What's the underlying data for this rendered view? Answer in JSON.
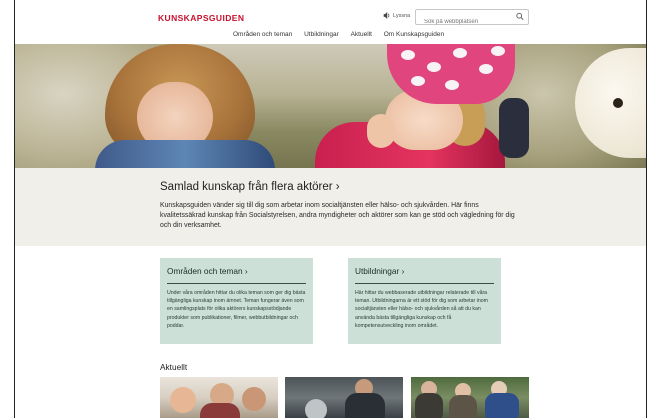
{
  "header": {
    "logo": "KUNSKAPSGUIDEN",
    "listen_label": "Lyssna",
    "search_placeholder": "Sök på webbplatsen"
  },
  "nav": {
    "items": [
      "Områden och teman",
      "Utbildningar",
      "Aktuellt",
      "Om Kunskapsguiden"
    ]
  },
  "intro": {
    "title": "Samlad kunskap från flera aktörer ›",
    "text": "Kunskapsguiden vänder sig till dig som arbetar inom socialtjänsten eller hälso- och sjukvården. Här finns kvalitetssäkrad kunskap från Socialstyrelsen, andra myndigheter och aktörer som kan ge stöd och vägledning för dig och din verksamhet."
  },
  "cards": [
    {
      "title": "Områden och teman ›",
      "text": "Under våra områden hittar du olika teman som ger dig bästa tillgängliga kunskap inom ämnet. Teman fungerar även som en samlingsplats för olika aktörers kunskapsstödjande produkter som publikationer, filmer, webbutbildningar och poddar."
    },
    {
      "title": "Utbildningar ›",
      "text": "Här hittar du webbaserade utbildningar relaterade till våra teman. Utbildningarna är ett stöd för dig som arbetar inom socialtjänsten eller hälso- och sjukvården så att du kan använda bästa tillgängliga kunskap och få kompetensutveckling inom området."
    }
  ],
  "news": {
    "title": "Aktuellt"
  },
  "colors": {
    "brand_red": "#c8102e",
    "card_green": "#cde0d8",
    "intro_bg": "#f1efea"
  },
  "icons": {
    "listen": "speaker-icon",
    "search": "magnifier-icon"
  }
}
